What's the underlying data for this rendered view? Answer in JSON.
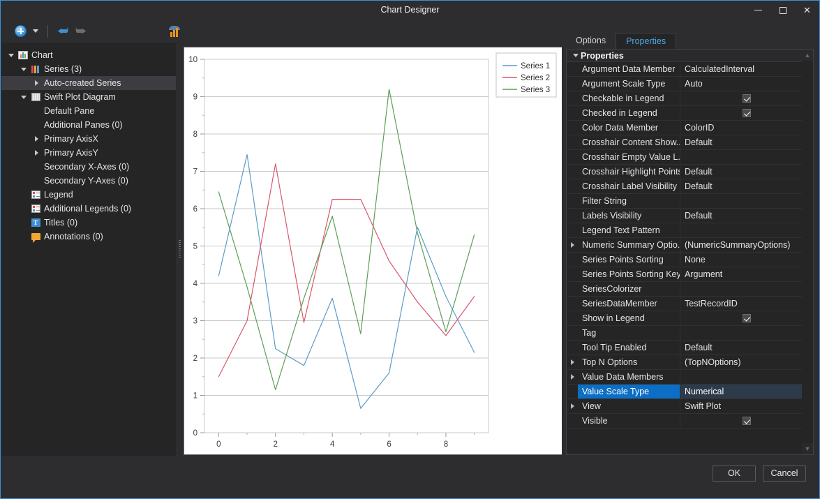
{
  "window": {
    "title": "Chart Designer",
    "controls": {
      "minimize": "minimize-icon",
      "maximize": "maximize-icon",
      "close": "close-icon"
    }
  },
  "toolbar": {
    "items": [
      {
        "name": "add-button",
        "icon": "plus-circle-icon"
      },
      {
        "name": "add-dropdown-button",
        "icon": "chevron-down-icon"
      },
      {
        "name": "undo-button",
        "icon": "undo-arrow-icon",
        "glyph": "⮨"
      },
      {
        "name": "redo-button",
        "icon": "redo-arrow-icon",
        "glyph": "⮩"
      },
      {
        "name": "chart-wizard-button",
        "icon": "chart-wizard-icon"
      }
    ]
  },
  "tree": {
    "nodes": [
      {
        "label": "Chart",
        "indent": 0,
        "expander": "open",
        "icon": "chart-icon",
        "selected": false
      },
      {
        "label": "Series (3)",
        "indent": 1,
        "expander": "open",
        "icon": "series-bars-icon",
        "selected": false
      },
      {
        "label": "Auto-created Series",
        "indent": 2,
        "expander": "closed",
        "icon": "none",
        "selected": true
      },
      {
        "label": "Swift Plot Diagram",
        "indent": 1,
        "expander": "open",
        "icon": "grid-icon",
        "selected": false
      },
      {
        "label": "Default Pane",
        "indent": 2,
        "expander": "none",
        "icon": "none",
        "selected": false
      },
      {
        "label": "Additional Panes (0)",
        "indent": 2,
        "expander": "none",
        "icon": "none",
        "selected": false
      },
      {
        "label": "Primary AxisX",
        "indent": 2,
        "expander": "closed",
        "icon": "none",
        "selected": false
      },
      {
        "label": "Primary AxisY",
        "indent": 2,
        "expander": "closed",
        "icon": "none",
        "selected": false
      },
      {
        "label": "Secondary X-Axes (0)",
        "indent": 2,
        "expander": "none",
        "icon": "none",
        "selected": false
      },
      {
        "label": "Secondary Y-Axes (0)",
        "indent": 2,
        "expander": "none",
        "icon": "none",
        "selected": false
      },
      {
        "label": "Legend",
        "indent": 1,
        "expander": "none",
        "icon": "legend-icon",
        "selected": false
      },
      {
        "label": "Additional Legends (0)",
        "indent": 1,
        "expander": "none",
        "icon": "legend-icon",
        "selected": false
      },
      {
        "label": "Titles (0)",
        "indent": 1,
        "expander": "none",
        "icon": "title-icon",
        "selected": false
      },
      {
        "label": "Annotations (0)",
        "indent": 1,
        "expander": "none",
        "icon": "annotation-icon",
        "selected": false
      }
    ]
  },
  "properties_panel": {
    "tabs": [
      {
        "label": "Options",
        "active": false
      },
      {
        "label": "Properties",
        "active": true
      }
    ],
    "group_header": "Properties",
    "scroll_up": "▲",
    "scroll_down": "▼",
    "rows": [
      {
        "name": "Argument Data Member",
        "value": "CalculatedInterval",
        "type": "text",
        "expander": false,
        "selected": false
      },
      {
        "name": "Argument Scale Type",
        "value": "Auto",
        "type": "text",
        "expander": false,
        "selected": false
      },
      {
        "name": "Checkable in Legend",
        "value": "",
        "type": "checkbox",
        "expander": false,
        "selected": false,
        "checked": true
      },
      {
        "name": "Checked in Legend",
        "value": "",
        "type": "checkbox",
        "expander": false,
        "selected": false,
        "checked": true
      },
      {
        "name": "Color Data Member",
        "value": "ColorID",
        "type": "text",
        "expander": false,
        "selected": false
      },
      {
        "name": "Crosshair Content Show...",
        "value": "Default",
        "type": "text",
        "expander": false,
        "selected": false
      },
      {
        "name": "Crosshair Empty Value L...",
        "value": "",
        "type": "text",
        "expander": false,
        "selected": false
      },
      {
        "name": "Crosshair Highlight Points",
        "value": "Default",
        "type": "text",
        "expander": false,
        "selected": false
      },
      {
        "name": "Crosshair Label Visibility",
        "value": "Default",
        "type": "text",
        "expander": false,
        "selected": false
      },
      {
        "name": "Filter String",
        "value": "",
        "type": "text",
        "expander": false,
        "selected": false
      },
      {
        "name": "Labels Visibility",
        "value": "Default",
        "type": "text",
        "expander": false,
        "selected": false
      },
      {
        "name": "Legend Text Pattern",
        "value": "",
        "type": "text",
        "expander": false,
        "selected": false
      },
      {
        "name": "Numeric Summary Optio...",
        "value": "(NumericSummaryOptions)",
        "type": "text",
        "expander": true,
        "selected": false
      },
      {
        "name": "Series Points Sorting",
        "value": "None",
        "type": "text",
        "expander": false,
        "selected": false
      },
      {
        "name": "Series Points Sorting Key",
        "value": "Argument",
        "type": "text",
        "expander": false,
        "selected": false
      },
      {
        "name": "SeriesColorizer",
        "value": "",
        "type": "text",
        "expander": false,
        "selected": false
      },
      {
        "name": "SeriesDataMember",
        "value": "TestRecordID",
        "type": "text",
        "expander": false,
        "selected": false
      },
      {
        "name": "Show in Legend",
        "value": "",
        "type": "checkbox",
        "expander": false,
        "selected": false,
        "checked": true
      },
      {
        "name": "Tag",
        "value": "",
        "type": "text",
        "expander": false,
        "selected": false
      },
      {
        "name": "Tool Tip Enabled",
        "value": "Default",
        "type": "text",
        "expander": false,
        "selected": false
      },
      {
        "name": "Top N Options",
        "value": "(TopNOptions)",
        "type": "text",
        "expander": true,
        "selected": false
      },
      {
        "name": "Value Data Members",
        "value": "",
        "type": "text",
        "expander": true,
        "selected": false
      },
      {
        "name": "Value Scale Type",
        "value": "Numerical",
        "type": "text",
        "expander": false,
        "selected": true
      },
      {
        "name": "View",
        "value": "Swift Plot",
        "type": "text",
        "expander": true,
        "selected": false
      },
      {
        "name": "Visible",
        "value": "",
        "type": "checkbox",
        "expander": false,
        "selected": false,
        "checked": true
      }
    ]
  },
  "footer": {
    "ok_label": "OK",
    "cancel_label": "Cancel"
  },
  "chart_data": {
    "type": "line",
    "title": "",
    "xlabel": "",
    "ylabel": "",
    "xlim": [
      -0.5,
      9.5
    ],
    "ylim": [
      0,
      10
    ],
    "xticks": [
      0,
      2,
      4,
      6,
      8
    ],
    "xminorticks": [
      1,
      3,
      5,
      7,
      9
    ],
    "yticks": [
      0,
      1,
      2,
      3,
      4,
      5,
      6,
      7,
      8,
      9,
      10
    ],
    "grid": "horizontal",
    "legend_position": "top-right",
    "background": "#ffffff",
    "x": [
      0,
      1,
      2,
      3,
      4,
      5,
      6,
      7,
      8,
      9
    ],
    "series": [
      {
        "name": "Series 1",
        "color": "#5b9bc9",
        "values": [
          4.2,
          7.45,
          2.25,
          1.8,
          3.6,
          0.65,
          1.6,
          5.5,
          3.65,
          2.15
        ]
      },
      {
        "name": "Series 2",
        "color": "#d9566c",
        "values": [
          1.5,
          3.0,
          7.2,
          2.95,
          6.25,
          6.25,
          4.6,
          3.5,
          2.6,
          3.65
        ]
      },
      {
        "name": "Series 3",
        "color": "#5d9e57",
        "values": [
          6.45,
          3.9,
          1.15,
          3.6,
          5.8,
          2.65,
          9.2,
          5.35,
          2.7,
          5.3
        ]
      }
    ]
  }
}
